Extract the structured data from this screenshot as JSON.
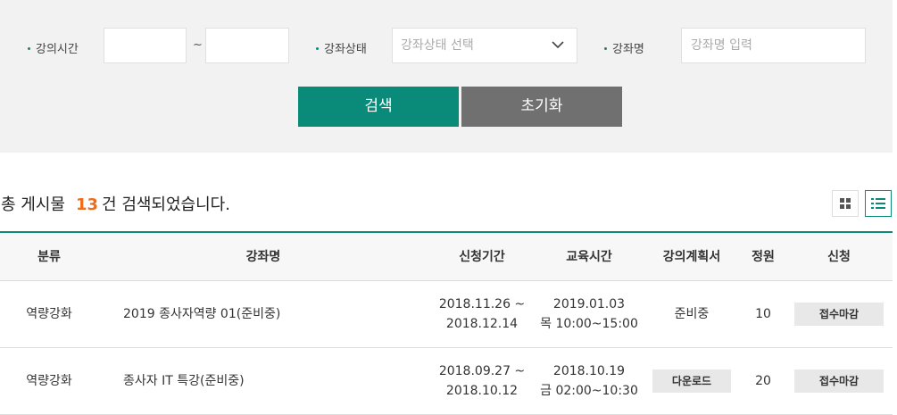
{
  "search": {
    "time_label": "강의시간",
    "time_start": "",
    "time_end": "",
    "tilde": "~",
    "status_label": "강좌상태",
    "status_placeholder": "강좌상태 선택",
    "name_label": "강좌명",
    "name_placeholder": "강좌명 입력",
    "search_button": "검색",
    "reset_button": "초기화"
  },
  "summary": {
    "prefix": "총 게시물",
    "count": "13",
    "suffix": "건 검색되었습니다."
  },
  "table": {
    "headers": [
      "분류",
      "강좌명",
      "신청기간",
      "교육시간",
      "강의계획서",
      "정원",
      "신청"
    ],
    "rows": [
      {
        "category": "역량강화",
        "title": "2019 종사자역량 01(준비중)",
        "period_start": "2018.11.26 ~",
        "period_end": "2018.12.14",
        "edu_date": "2019.01.03",
        "edu_time": "목 10:00~15:00",
        "plan": "준비중",
        "capacity": "10",
        "apply": "접수마감"
      },
      {
        "category": "역량강화",
        "title": "종사자 IT 특강(준비중)",
        "period_start": "2018.09.27 ~",
        "period_end": "2018.10.12",
        "edu_date": "2018.10.19",
        "edu_time": "금 02:00~10:30",
        "plan": "다운로드",
        "capacity": "20",
        "apply": "접수마감"
      }
    ]
  },
  "colors": {
    "accent": "#0a8a78",
    "reset": "#707070",
    "count": "#f06b1a"
  }
}
